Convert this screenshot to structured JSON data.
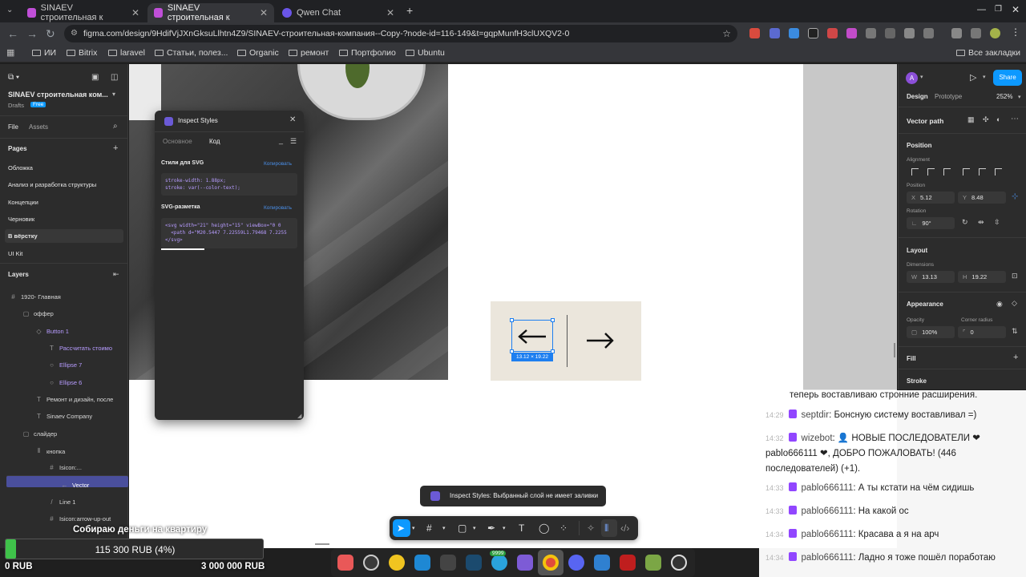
{
  "browser": {
    "tabs": [
      {
        "title": "SINAEV строительная к",
        "active": false
      },
      {
        "title": "SINAEV строительная к",
        "active": true
      },
      {
        "title": "Qwen Chat",
        "active": false
      }
    ],
    "url": "figma.com/design/9HdifVjJXnGksuLlhtn4Z9/SINAEV-строительная-компания--Copy-?node-id=116-149&t=gqpMunfH3clUXQV2-0",
    "bookmarks": [
      "ИИ",
      "Bitrix",
      "laravel",
      "Статьи, полез...",
      "Organic",
      "ремонт",
      "Портфолио",
      "Ubuntu"
    ],
    "all_bookmarks": "Все закладки"
  },
  "figma": {
    "file_title": "SINAEV строительная ком...",
    "drafts": "Drafts",
    "plan_badge": "Free",
    "tabs": {
      "file": "File",
      "assets": "Assets"
    },
    "pages_header": "Pages",
    "pages": [
      "Обложка",
      "Анализ и разработка структуры",
      "Концепции",
      "Черновик",
      "В вёрстку",
      "UI Kit"
    ],
    "layers_header": "Layers",
    "layers": [
      {
        "label": "1920- Главная",
        "icon": "#",
        "depth": 0,
        "purple": false
      },
      {
        "label": "оффер",
        "icon": "▢",
        "depth": 1,
        "purple": false
      },
      {
        "label": "Button 1",
        "icon": "◇",
        "depth": 2,
        "purple": true
      },
      {
        "label": "Рассчитать стоимо",
        "icon": "T",
        "depth": 3,
        "purple": true
      },
      {
        "label": "Ellipse 7",
        "icon": "○",
        "depth": 3,
        "purple": true
      },
      {
        "label": "Ellipse 6",
        "icon": "○",
        "depth": 3,
        "purple": true
      },
      {
        "label": "Ремонт и дизайн, после",
        "icon": "T",
        "depth": 2,
        "purple": false
      },
      {
        "label": "Sinaev Company",
        "icon": "T",
        "depth": 2,
        "purple": false
      },
      {
        "label": "слайдер",
        "icon": "▢",
        "depth": 1,
        "purple": false
      },
      {
        "label": "кнопка",
        "icon": "⦀",
        "depth": 2,
        "purple": false
      },
      {
        "label": "Isicon:...",
        "icon": "#",
        "depth": 3,
        "purple": false
      },
      {
        "label": "Vector",
        "icon": "←",
        "depth": 4,
        "purple": false
      },
      {
        "label": "Line 1",
        "icon": "/",
        "depth": 3,
        "purple": false
      },
      {
        "label": "Isicon:arrow-up-out",
        "icon": "#",
        "depth": 3,
        "purple": false
      }
    ],
    "selection_size": "13.12 × 19.22",
    "inspect": {
      "title": "Inspect Styles",
      "tab_basic": "Основное",
      "tab_code": "Код",
      "svg_styles_title": "Стили для SVG",
      "copy": "Копировать",
      "svg_styles_code": "stroke-width: 1.88px;\nstroke: var(--color-text);",
      "svg_markup_title": "SVG-разметка",
      "svg_markup_code": "<svg width=\"21\" height=\"15\" viewBox=\"0 0 \n  <path d=\"M20.5447 7.22559L1.79468 7.2255\n</svg>"
    },
    "right": {
      "avatar": "A",
      "share": "Share",
      "tab_design": "Design",
      "tab_prototype": "Prototype",
      "zoom": "252%",
      "selection_type": "Vector path",
      "position": "Position",
      "alignment": "Alignment",
      "position_sub": "Position",
      "x": "5.12",
      "y": "8.48",
      "rotation_label": "Rotation",
      "rotation": "90°",
      "layout": "Layout",
      "dimensions": "Dimensions",
      "w": "13.13",
      "h": "19.22",
      "appearance": "Appearance",
      "opacity_label": "Opacity",
      "opacity": "100%",
      "corner_label": "Corner radius",
      "corner": "0",
      "fill": "Fill",
      "stroke": "Stroke"
    },
    "toast": "Inspect Styles: Выбранный слой не имеет заливки"
  },
  "chat": [
    {
      "time": "",
      "user": "",
      "text": "теперь воставливаю стронние расширения."
    },
    {
      "time": "14:29",
      "user": "septdir",
      "text": "Бонсную систему воставливал =)"
    },
    {
      "time": "14:32",
      "user": "wizebot",
      "text": "👤 НОВЫЕ ПОСЛЕДОВАТЕЛИ ❤ pablo666111 ❤, ДОБРО ПОЖАЛОВАТЬ! (446 последователей) (+1)."
    },
    {
      "time": "14:33",
      "user": "pablo666111",
      "text": "А ты кстати на чём сидишь"
    },
    {
      "time": "14:33",
      "user": "pablo666111",
      "text": "На какой ос"
    },
    {
      "time": "14:34",
      "user": "pablo666111",
      "text": "Красава а я на арч"
    },
    {
      "time": "14:34",
      "user": "pablo666111",
      "text": "Ладно я тоже пошёл поработаю"
    }
  ],
  "donation": {
    "title": "Собираю деньги на квартиру",
    "current": "115 300 RUB (4%)",
    "progress_percent": 4,
    "min": "0 RUB",
    "goal": "3 000 000 RUB"
  },
  "dock_badge": "9999",
  "colors": {
    "figma_purple": "#b79cff",
    "share_blue": "#0d99ff",
    "selection": "#1e7ff0",
    "progress_green": "#3fc24a"
  }
}
